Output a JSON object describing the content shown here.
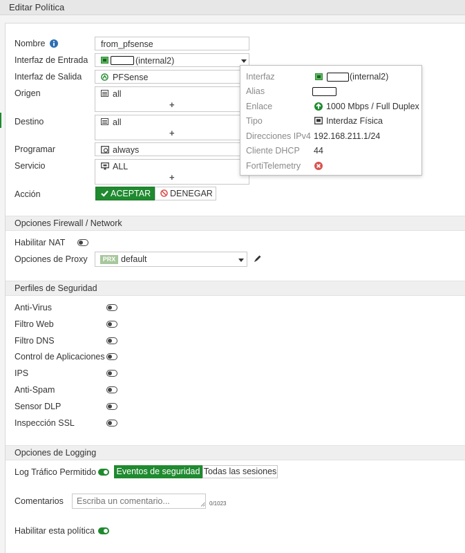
{
  "header": {
    "title": "Editar Política"
  },
  "form": {
    "nombre": {
      "label": "Nombre",
      "value": "from_pfsense"
    },
    "entrada": {
      "label": "Interfaz de Entrada",
      "value": "(internal2)"
    },
    "salida": {
      "label": "Interfaz de Salida",
      "value": "PFSense"
    },
    "origen": {
      "label": "Origen",
      "value": "all",
      "add": "+"
    },
    "destino": {
      "label": "Destino",
      "value": "all",
      "add": "+"
    },
    "programar": {
      "label": "Programar",
      "value": "always"
    },
    "servicio": {
      "label": "Servicio",
      "value": "ALL",
      "add": "+"
    },
    "accion": {
      "label": "Acción",
      "accept": "ACEPTAR",
      "deny": "DENEGAR",
      "selected": "ACEPTAR"
    }
  },
  "popover": {
    "rows": [
      {
        "key": "Interfaz",
        "value": "(internal2)"
      },
      {
        "key": "Alias",
        "value": ""
      },
      {
        "key": "Enlace",
        "value": "1000 Mbps / Full Duplex"
      },
      {
        "key": "Tipo",
        "value": "Interdaz Física"
      },
      {
        "key": "Direcciones IPv4",
        "value": "192.168.211.1/24"
      },
      {
        "key": "Cliente DHCP",
        "value": "44"
      },
      {
        "key": "FortiTelemetry",
        "value": ""
      }
    ]
  },
  "firewall": {
    "title": "Opciones Firewall / Network",
    "nat": {
      "label": "Habilitar NAT",
      "enabled": false
    },
    "proxy": {
      "label": "Opciones de Proxy",
      "badge": "PRX",
      "value": "default"
    }
  },
  "security": {
    "title": "Perfiles de Seguridad",
    "items": [
      {
        "label": "Anti-Virus",
        "enabled": false
      },
      {
        "label": "Filtro Web",
        "enabled": false
      },
      {
        "label": "Filtro DNS",
        "enabled": false
      },
      {
        "label": "Control de Aplicaciones",
        "enabled": false
      },
      {
        "label": "IPS",
        "enabled": false
      },
      {
        "label": "Anti-Spam",
        "enabled": false
      },
      {
        "label": "Sensor DLP",
        "enabled": false
      },
      {
        "label": "Inspección SSL",
        "enabled": false
      }
    ]
  },
  "logging": {
    "title": "Opciones de Logging",
    "label": "Log Tráfico Permitido",
    "enabled": true,
    "options": [
      "Eventos de seguridad",
      "Todas las sesiones"
    ],
    "selected": "Eventos de seguridad"
  },
  "comments": {
    "label": "Comentarios",
    "placeholder": "Escriba un comentario...",
    "counter": "0/1023"
  },
  "enable_policy": {
    "label": "Habilitar esta política",
    "enabled": true
  },
  "colors": {
    "accent_green": "#1f8a2f",
    "error_red": "#d9534f",
    "header_bg": "#e7e7e7"
  }
}
